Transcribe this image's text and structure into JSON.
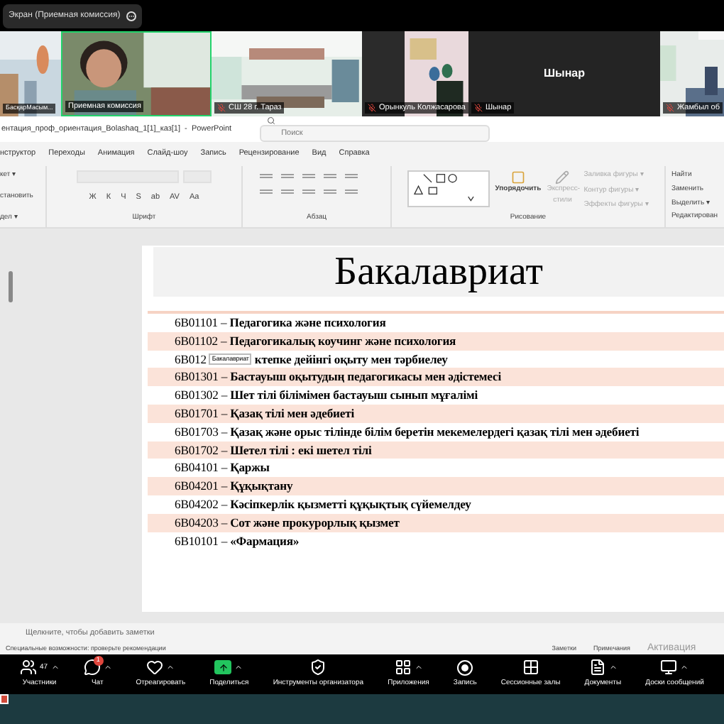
{
  "share_bar": {
    "label": "Экран (Приемная комиссия)"
  },
  "videos": [
    {
      "kind": "picture",
      "name": "БасқарМасым...",
      "speaking": false,
      "muted": false
    },
    {
      "kind": "person",
      "name": "Приемная комиссия",
      "speaking": true,
      "muted": false
    },
    {
      "kind": "picture",
      "name": "СШ 28 г. Тараз",
      "speaking": false,
      "muted": true
    },
    {
      "kind": "picture",
      "name": "Орынкуль Колжасарова",
      "speaking": false,
      "muted": true
    },
    {
      "kind": "no_video",
      "name": "Шынар",
      "center_name": "Шынар",
      "speaking": false,
      "muted": true
    },
    {
      "kind": "picture",
      "name": "Жамбыл об",
      "speaking": false,
      "muted": true
    }
  ],
  "app_title": "ентация_проф_ориентация_Bolashaq_1[1]_каз[1]  -  PowerPoint",
  "search": {
    "placeholder": "Поиск"
  },
  "tabs": [
    "нструктор",
    "Переходы",
    "Анимация",
    "Слайд-шоу",
    "Запись",
    "Рецензирование",
    "Вид",
    "Справка"
  ],
  "ribbon": {
    "slides_items": [
      "кет ▾",
      "становить",
      "дел ▾"
    ],
    "font_buttons": [
      "Ж",
      "К",
      "Ч",
      "S",
      "ab",
      "AV",
      "Aa"
    ],
    "groups": [
      "Шрифт",
      "Абзац",
      "Рисование",
      "Редактирован"
    ],
    "arrange": "Упорядочить",
    "quick_styles": "Экспресс-стили",
    "shape_options": [
      "Заливка фигуры ▾",
      "Контур фигуры ▾",
      "Эффекты фигуры ▾"
    ],
    "editing": [
      "Найти",
      "Заменить",
      "Выделить ▾"
    ]
  },
  "slide": {
    "title": "Бакалавриат",
    "rows": [
      {
        "code": "6B01101 –",
        "title": "Педагогика және психология"
      },
      {
        "code": "6B01102 –",
        "title": "Педагогикалық коучинг және  психология"
      },
      {
        "code": "6B012",
        "tooltip": "Бакалавриат",
        "title": "ктепке дейінгі оқыту мен тәрбиелеу"
      },
      {
        "code": "6B01301 –",
        "title": "Бастауыш оқытудың педагогикасы мен әдістемесі"
      },
      {
        "code": "6B01302 –",
        "title": "Шет тілі білімімен бастауыш сынып мұғалімі"
      },
      {
        "code": "6B01701 –",
        "title": "Қазақ тілі мен әдебиеті"
      },
      {
        "code": "6B01703 –",
        "title": "Қазақ және орыс тілінде білім беретін мекемелердегі қазақ тілі мен әдебиеті"
      },
      {
        "code": "6B01702 –",
        "title": "Шетел тілі : екі шетел тілі"
      },
      {
        "code": "6B04101 –",
        "title": "Қаржы"
      },
      {
        "code": "6B04201 –",
        "title": "Құқықтану"
      },
      {
        "code": "6B04202 –",
        "title": "Кәсіпкерлік қызметті құқықтық сүйемелдеу"
      },
      {
        "code": "6B04203 –",
        "title": "Сот және прокурорлық қызмет"
      },
      {
        "code": "6B10101 –",
        "title": "«Фармация»"
      }
    ]
  },
  "notes": {
    "placeholder": "Щелкните, чтобы добавить заметки"
  },
  "status_bar": {
    "accessibility": "Специальные возможности: проверьте рекомендации",
    "buttons": [
      "Заметки",
      "Примечания"
    ],
    "activation": "Активация"
  },
  "toolbar": [
    {
      "kind": "participants",
      "label": "Участники",
      "count": "47",
      "menu": true
    },
    {
      "kind": "chat",
      "label": "Чат",
      "badge": "1",
      "menu": true
    },
    {
      "kind": "react",
      "label": "Отреагировать",
      "menu": true
    },
    {
      "kind": "share",
      "label": "Поделиться",
      "menu": true
    },
    {
      "kind": "host",
      "label": "Инструменты организатора",
      "menu": false
    },
    {
      "kind": "apps",
      "label": "Приложения",
      "menu": true
    },
    {
      "kind": "record",
      "label": "Запись",
      "menu": false
    },
    {
      "kind": "rooms",
      "label": "Сессионные залы",
      "menu": false
    },
    {
      "kind": "docs",
      "label": "Документы",
      "menu": true
    },
    {
      "kind": "whiteboard",
      "label": "Доски сообщений",
      "menu": true
    }
  ]
}
